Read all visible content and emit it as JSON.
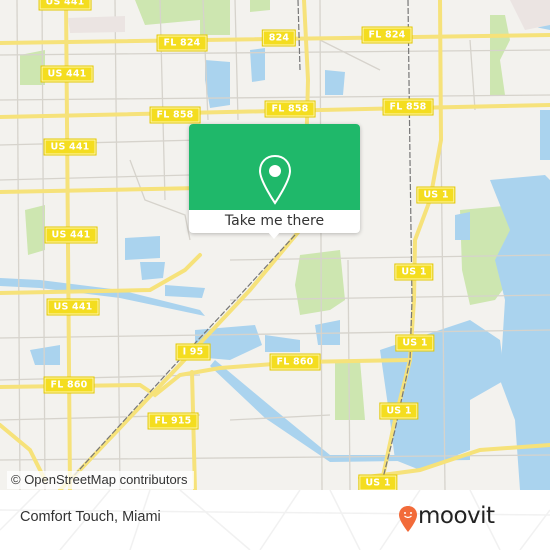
{
  "map": {
    "attribution": "© OpenStreetMap contributors",
    "colors": {
      "land": "#f3f2ee",
      "water": "#aad3ee",
      "park": "#cde6b0",
      "major_road": "#f6e27a",
      "minor_road": "#d6d3cc",
      "rail": "#777777",
      "shield_bg": "#f4dd1f"
    },
    "road_labels": [
      {
        "text": "US 441",
        "id": "us441-a"
      },
      {
        "text": "FL 824",
        "id": "fl824-a"
      },
      {
        "text": "824",
        "id": "fl824-b"
      },
      {
        "text": "FL 824",
        "id": "fl824-c"
      },
      {
        "text": "US 441",
        "id": "us441-b"
      },
      {
        "text": "FL 858",
        "id": "fl858-a"
      },
      {
        "text": "FL 858",
        "id": "fl858-b"
      },
      {
        "text": "FL 858",
        "id": "fl858-c"
      },
      {
        "text": "US 441",
        "id": "us441-c"
      },
      {
        "text": "US 1",
        "id": "us1-a"
      },
      {
        "text": "US 441",
        "id": "us441-d"
      },
      {
        "text": "US 1",
        "id": "us1-b"
      },
      {
        "text": "US 441",
        "id": "us441-e"
      },
      {
        "text": "I 95",
        "id": "i95"
      },
      {
        "text": "FL 860",
        "id": "fl860-a"
      },
      {
        "text": "US 1",
        "id": "us1-c"
      },
      {
        "text": "FL 860",
        "id": "fl860-b"
      },
      {
        "text": "US 1",
        "id": "us1-d"
      },
      {
        "text": "FL 915",
        "id": "fl915"
      },
      {
        "text": "US 1",
        "id": "us1-e"
      }
    ]
  },
  "popup": {
    "action_label": "Take me there",
    "icon": "map-pin-icon",
    "color": "#1fb86a"
  },
  "footer": {
    "place_name": "Comfort Touch, Miami",
    "brand": "moovit",
    "brand_icon": "moovit-smiley-pin-icon",
    "brand_color": "#f26b3a"
  }
}
